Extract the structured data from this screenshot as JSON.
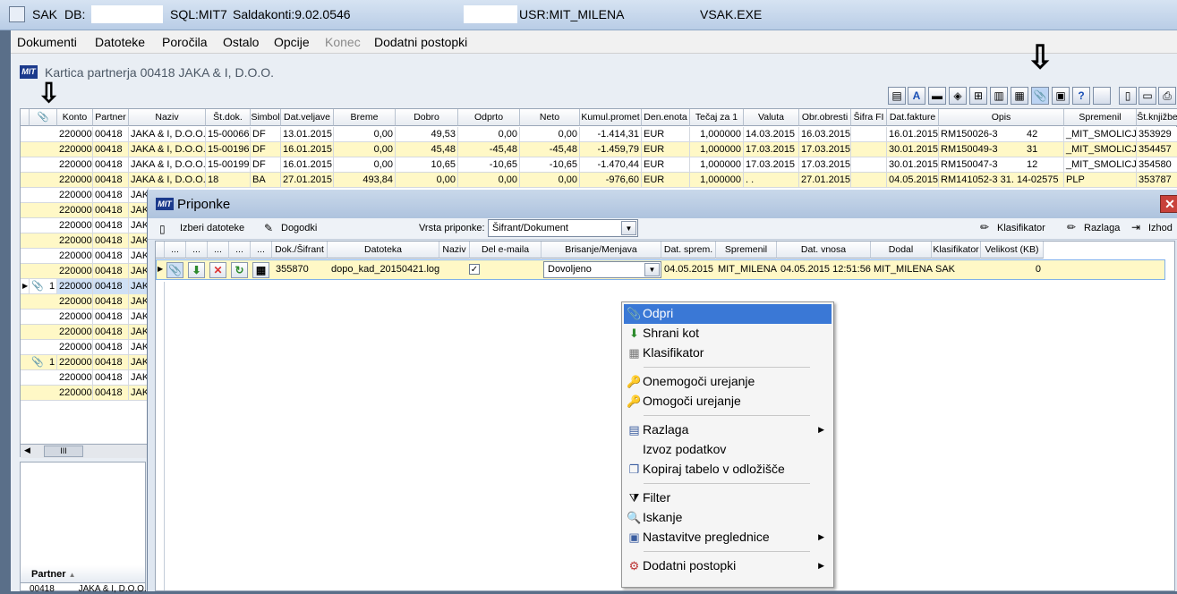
{
  "titlebar": {
    "app": "SAK",
    "db_label": "DB:",
    "sql": "SQL:MIT7",
    "saldakonti": "Saldakonti:9.02.0546",
    "usr": "USR:MIT_MILENA",
    "exe": "VSAK.EXE"
  },
  "menu": {
    "items": [
      "Dokumenti",
      "Datoteke",
      "Poročila",
      "Ostalo",
      "Opcije",
      "Konec",
      "Dodatni postopki"
    ]
  },
  "kartica": {
    "title": "Kartica partnerja 00418 JAKA & I, D.O.O.",
    "logo": "MIT"
  },
  "grid": {
    "columns": [
      "Konto",
      "Partner",
      "Naziv",
      "Št.dok.",
      "Simbol",
      "Dat.veljave",
      "Breme",
      "Dobro",
      "Odprto",
      "Neto",
      "Kumul.promet",
      "Den.enota",
      "Tečaj za 1",
      "Valuta",
      "Obr.obresti",
      "Šifra FI",
      "Dat.fakture",
      "Opis",
      "Spremenil",
      "Št.knjižbe"
    ],
    "rows": [
      [
        "220000",
        "00418",
        "JAKA & I, D.O.O.",
        "15-00066",
        "DF",
        "13.01.2015",
        "0,00",
        "49,53",
        "0,00",
        "0,00",
        "-1.414,31",
        "EUR",
        "1,000000",
        "14.03.2015",
        "16.03.2015",
        "",
        "16.01.2015",
        "RM150026-3",
        "42",
        "_MIT_SMOLICJ",
        "353929"
      ],
      [
        "220000",
        "00418",
        "JAKA & I, D.O.O.",
        "15-00196",
        "DF",
        "16.01.2015",
        "0,00",
        "45,48",
        "-45,48",
        "-45,48",
        "-1.459,79",
        "EUR",
        "1,000000",
        "17.03.2015",
        "17.03.2015",
        "",
        "30.01.2015",
        "RM150049-3",
        "31",
        "_MIT_SMOLICJ",
        "354457"
      ],
      [
        "220000",
        "00418",
        "JAKA & I, D.O.O.",
        "15-00199",
        "DF",
        "16.01.2015",
        "0,00",
        "10,65",
        "-10,65",
        "-10,65",
        "-1.470,44",
        "EUR",
        "1,000000",
        "17.03.2015",
        "17.03.2015",
        "",
        "30.01.2015",
        "RM150047-3",
        "12",
        "_MIT_SMOLICJ",
        "354580"
      ],
      [
        "220000",
        "00418",
        "JAKA & I, D.O.O.",
        "18",
        "BA",
        "27.01.2015",
        "493,84",
        "0,00",
        "0,00",
        "0,00",
        "-976,60",
        "EUR",
        "1,000000",
        ". .",
        "27.01.2015",
        "",
        "04.05.2015",
        "RM141052-3 31. 14-02575",
        "",
        "PLP",
        "353787"
      ]
    ],
    "partial_rows": [
      {
        "konto": "220000",
        "partner": "00418",
        "naziv": "JAK",
        "attach": "",
        "cur": false
      },
      {
        "konto": "220000",
        "partner": "00418",
        "naziv": "JAK",
        "attach": "",
        "cur": false
      },
      {
        "konto": "220000",
        "partner": "00418",
        "naziv": "JAK",
        "attach": "",
        "cur": false
      },
      {
        "konto": "220000",
        "partner": "00418",
        "naziv": "JAK",
        "attach": "",
        "cur": false
      },
      {
        "konto": "220000",
        "partner": "00418",
        "naziv": "JAK",
        "attach": "",
        "cur": false
      },
      {
        "konto": "220000",
        "partner": "00418",
        "naziv": "JAK",
        "attach": "",
        "cur": false
      },
      {
        "konto": "220000",
        "partner": "00418",
        "naziv": "JAK",
        "attach": "1",
        "cur": true
      },
      {
        "konto": "220000",
        "partner": "00418",
        "naziv": "JAK",
        "attach": "",
        "cur": false
      },
      {
        "konto": "220000",
        "partner": "00418",
        "naziv": "JAK",
        "attach": "",
        "cur": false
      },
      {
        "konto": "220000",
        "partner": "00418",
        "naziv": "JAK",
        "attach": "",
        "cur": false
      },
      {
        "konto": "220000",
        "partner": "00418",
        "naziv": "JAK",
        "attach": "",
        "cur": false
      },
      {
        "konto": "220000",
        "partner": "00418",
        "naziv": "JAK",
        "attach": "1",
        "cur": false
      },
      {
        "konto": "220000",
        "partner": "00418",
        "naziv": "JAK",
        "attach": "",
        "cur": false
      },
      {
        "konto": "220000",
        "partner": "00418",
        "naziv": "JAK",
        "attach": "",
        "cur": false
      }
    ],
    "scroll_label": "III"
  },
  "partner_panel": {
    "header": "Partner",
    "row_partner": "00418",
    "row_naziv": "JAKA & I, D.O.O."
  },
  "dialog": {
    "title": "Priponke",
    "logo": "MIT",
    "toolbar": {
      "izberi": "Izberi datoteke",
      "dogodki": "Dogodki",
      "vrsta_label": "Vrsta priponke:",
      "vrsta_value": "Šifrant/Dokument",
      "klasifikator": "Klasifikator",
      "razlaga": "Razlaga",
      "izhod": "Izhod"
    },
    "columns": [
      "...",
      "...",
      "...",
      "...",
      "...",
      "Dok./Šifrant",
      "Datoteka",
      "Naziv",
      "Del e-maila",
      "Brisanje/Menjava",
      "Dat. sprem.",
      "Spremenil",
      "Dat. vnosa",
      "Dodal",
      "Klasifikator",
      "Velikost (KB)"
    ],
    "row": {
      "dok": "355870",
      "datoteka": "dopo_kad_20150421.log",
      "naziv": "",
      "email_checked": "✓",
      "brisanje": "Dovoljeno",
      "dat_sprem": "04.05.2015",
      "spremenil": "MIT_MILENA",
      "dat_vnosa": "04.05.2015 12:51:56",
      "dodal": "MIT_MILENA",
      "klasifikator": "SAK",
      "velikost": "0"
    }
  },
  "context_menu": {
    "items": [
      {
        "label": "Odpri",
        "icon": "paperclip-icon",
        "glyph": "📎"
      },
      {
        "label": "Shrani kot",
        "icon": "download-icon",
        "glyph": "⬇"
      },
      {
        "label": "Klasifikator",
        "icon": "classifier-icon",
        "glyph": "▦"
      },
      {
        "label": "Onemogoči urejanje",
        "icon": "key-icon",
        "glyph": "🔑"
      },
      {
        "label": "Omogoči urejanje",
        "icon": "key-icon",
        "glyph": "🔑"
      },
      {
        "label": "Razlaga",
        "icon": "book-icon",
        "glyph": "▤"
      },
      {
        "label": "Izvoz podatkov",
        "icon": "",
        "glyph": ""
      },
      {
        "label": "Kopiraj tabelo v odložišče",
        "icon": "copy-icon",
        "glyph": "❐"
      },
      {
        "label": "Filter",
        "icon": "filter-icon",
        "glyph": "⧩"
      },
      {
        "label": "Iskanje",
        "icon": "search-icon",
        "glyph": "🔍"
      },
      {
        "label": "Nastavitve preglednice",
        "icon": "settings-icon",
        "glyph": "▣"
      },
      {
        "label": "Dodatni postopki",
        "icon": "gear-icon",
        "glyph": "⚙"
      }
    ],
    "submenu_arrow": "▶"
  },
  "colors": {
    "accent": "#3a78d6",
    "row_yellow": "#fff8c6",
    "logo_blue": "#1b3a8c"
  }
}
